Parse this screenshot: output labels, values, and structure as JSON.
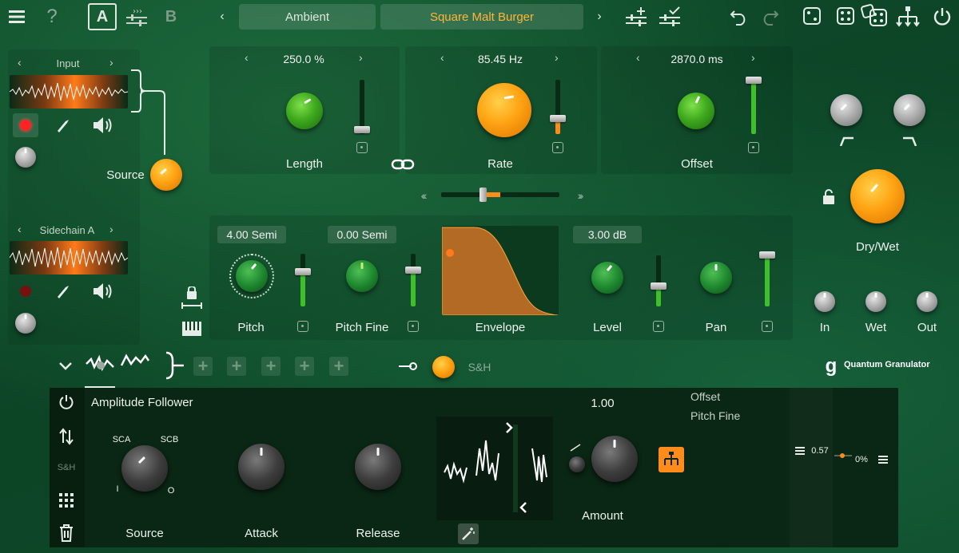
{
  "header": {
    "preset_a_label": "A",
    "preset_b_label": "B",
    "bank_name": "Ambient",
    "preset_name": "Square Malt Burger",
    "help_label": "?"
  },
  "sources": {
    "input_label": "Input",
    "sidechain_label": "Sidechain A",
    "source_label": "Source"
  },
  "grain": {
    "length": {
      "value": "250.0 %",
      "label": "Length"
    },
    "rate": {
      "value": "85.45 Hz",
      "label": "Rate"
    },
    "offset": {
      "value": "2870.0 ms",
      "label": "Offset"
    }
  },
  "voice": {
    "pitch": {
      "value": "4.00 Semi",
      "label": "Pitch"
    },
    "pitch_fine": {
      "value": "0.00 Semi",
      "label": "Pitch Fine"
    },
    "envelope_label": "Envelope",
    "level": {
      "value": "3.00 dB",
      "label": "Level"
    },
    "pan_label": "Pan"
  },
  "output": {
    "dry_wet_label": "Dry/Wet",
    "in_label": "In",
    "wet_label": "Wet",
    "out_label": "Out"
  },
  "mod_bar": {
    "sh_label": "S&H",
    "brand": "Quantum Granulator",
    "brand_glyph": "g"
  },
  "modulator": {
    "title": "Amplitude Follower",
    "sh_side_label": "S&H",
    "source_label": "Source",
    "sca": "SCA",
    "scb": "SCB",
    "i": "I",
    "o": "O",
    "attack_label": "Attack",
    "release_label": "Release",
    "amount_value": "1.00",
    "amount_label": "Amount",
    "targets": [
      "Offset",
      "Pitch Fine"
    ],
    "depth_value": "0.57",
    "depth_percent": "0%"
  },
  "colors": {
    "accent": "#ff9f1a",
    "green": "#3faa1e"
  }
}
